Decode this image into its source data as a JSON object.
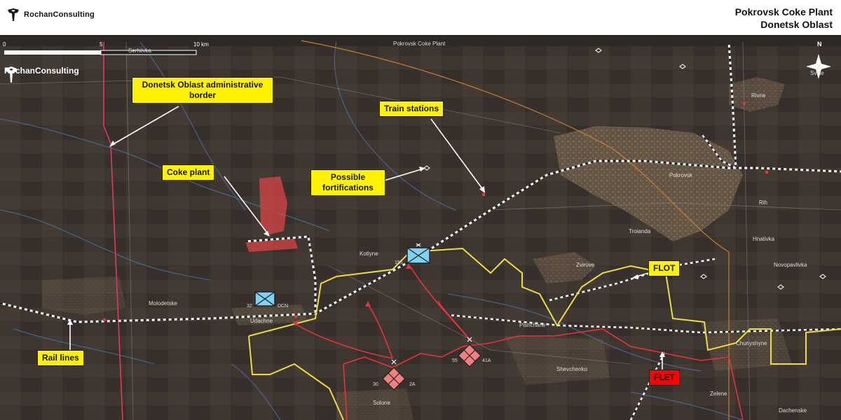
{
  "header": {
    "brand": "RochanConsulting",
    "title_line1": "Pokrovsk Coke Plant",
    "title_line2": "Donetsk Oblast"
  },
  "map": {
    "watermark": "RochanConsulting",
    "north_label": "N",
    "scale": {
      "tick0": "0",
      "tick1": "5",
      "tick2": "10 km"
    },
    "places": {
      "serhiivka": "Serhiivka",
      "pokrovsk_coke_plant": "Pokrovsk Coke Plant",
      "svitle": "Svitle",
      "rivne": "Rivne",
      "pokrovsk": "Pokrovsk",
      "rih": "Rih",
      "troianda": "Troianda",
      "hnativka": "Hnativka",
      "zvirove": "Zvirove",
      "novopavlivka": "Novopavlivka",
      "kotlyne": "Kotlyne",
      "molodetske": "Molodetske",
      "udachne": "Udachne",
      "pishchane": "Pishchane",
      "chunyshyne": "Chunyshyne",
      "shevchenko": "Shevchenko",
      "zelene": "Zelene",
      "dachenske": "Dachenske",
      "solone": "Solone"
    },
    "callouts": {
      "border": "Donetsk Oblast administrative border",
      "train_stations": "Train stations",
      "coke_plant": "Coke plant",
      "fortifications": "Possible fortifications",
      "flot": "FLOT",
      "flet": "FLET",
      "rail_lines": "Rail lines"
    },
    "units": {
      "ua_155": "155",
      "ua_32": "32",
      "ua_dcn": "DCN",
      "ru_55": "55",
      "ru_41a": "41A",
      "ru_30": "30",
      "ru_2a": "2A"
    },
    "colors": {
      "flot_line": "#f0dc3c",
      "flet_line": "#e8323c",
      "oblast_border": "#e23a5a",
      "ukraine_unit": "#7fd3f0",
      "russia_unit": "#f08080",
      "callout_yellow": "#fff200",
      "callout_red": "#ff0000"
    }
  }
}
